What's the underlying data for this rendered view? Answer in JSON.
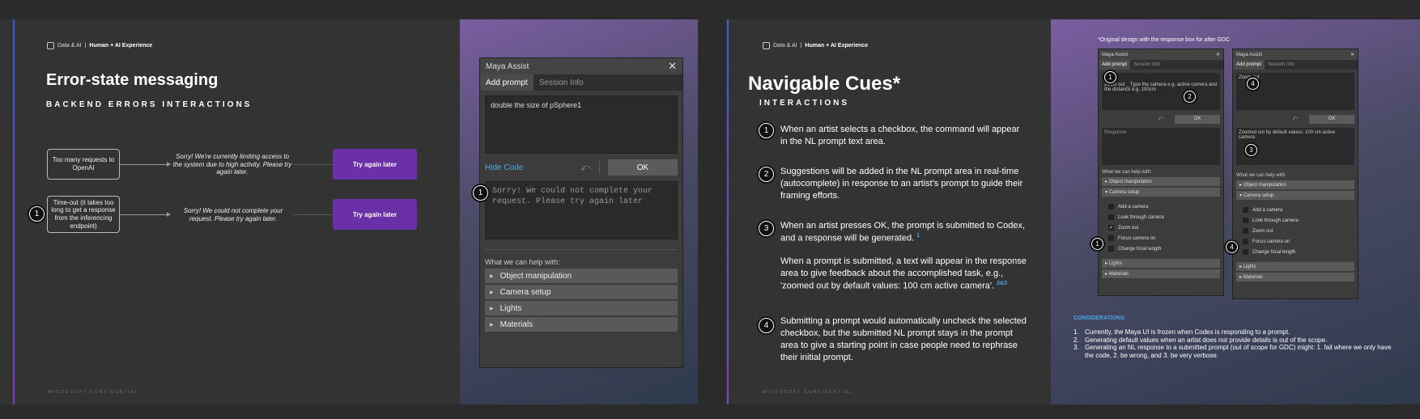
{
  "slide1": {
    "brand": {
      "org": "Data & AI",
      "team": "Human + AI Experience"
    },
    "title": "Error-state messaging",
    "subtitle": "BACKEND ERRORS INTERACTIONS",
    "flows": [
      {
        "cause": "Too many requests to OpenAI",
        "message": "Sorry! We're currently limiting access to the system due to high activity. Please try again later.",
        "action": "Try again later"
      },
      {
        "cause": "Time-out (it takes too long to get a response from the inferencing endpoint)",
        "message": "Sorry! We could not complete your request. Please try again later.",
        "action": "Try again later"
      }
    ],
    "badge": "1",
    "confidential": "MICROSOFT CONFIDENTIAL",
    "maya": {
      "title": "Maya Assist",
      "tabs": [
        "Add prompt",
        "Session Info"
      ],
      "prompt": "double the size of pSphere1",
      "hide_code": "Hide Code",
      "ok": "OK",
      "response": "Sorry! We could not complete your request. Please try again later",
      "help_label": "What we can help with:",
      "categories": [
        "Object manipulation",
        "Camera setup",
        "Lights",
        "Materials"
      ]
    }
  },
  "slide2": {
    "brand": {
      "org": "Data & AI",
      "team": "Human + AI Experience"
    },
    "title": "Navigable Cues*",
    "subtitle": "INTERACTIONS",
    "cues": [
      {
        "n": "1",
        "text": "When an artist selects a checkbox, the command will appear in the NL prompt text area.",
        "sup": ""
      },
      {
        "n": "2",
        "text": "Suggestions will be added in the NL prompt area in real-time (autocomplete) in response to an artist's prompt to guide their framing efforts.",
        "sup": ""
      },
      {
        "n": "3",
        "text": "When an artist presses OK, the prompt is submitted to Codex, and a response will be generated.",
        "sup": "1"
      },
      {
        "n": "",
        "text": "When a prompt is submitted, a text will appear in the response area to give feedback about the accomplished task, e.g., 'zoomed out by default values: 100 cm active camera'.",
        "sup": "2&3"
      },
      {
        "n": "4",
        "text": "Submitting a prompt would automatically uncheck the selected checkbox, but the submitted NL prompt stays in the prompt area to give a starting point in case people need to rephrase their initial prompt.",
        "sup": ""
      }
    ],
    "note": "*Original design with the response box for after GDC",
    "confidential": "MICROSOFT CONFIDENTIAL",
    "left_dialog": {
      "title": "Maya Assist",
      "tabs": [
        "Add prompt",
        "Session Info"
      ],
      "prompt": "Zoom out _ Type the camera e.g. active camera and the distance e.g. 100cm",
      "ok": "OK",
      "response_placeholder": "Response",
      "help_label": "What we can help with:",
      "categories": [
        "Object manipulation",
        "Camera setup"
      ],
      "camera_items": [
        "Add a camera",
        "Look through camera",
        "Zoom out",
        "Focus camera on",
        "Change focal length"
      ],
      "checked_index": 2,
      "more": [
        "Lights",
        "Materials"
      ]
    },
    "right_dialog": {
      "title": "Maya Assist",
      "tabs": [
        "Add prompt",
        "Session Info"
      ],
      "prompt": "Zoom out",
      "ok": "OK",
      "response": "Zoomed out by default values: 100 cm active camera",
      "help_label": "What we can help with:",
      "categories": [
        "Object manipulation",
        "Camera setup"
      ],
      "camera_items": [
        "Add a camera",
        "Look through camera",
        "Zoom out",
        "Focus camera on",
        "Change focal length"
      ],
      "more": [
        "Lights",
        "Materials"
      ]
    },
    "considerations_title": "CONSIDERATIONS",
    "considerations": [
      "Currently, the Maya UI is frozen when Codex is responding to a prompt.",
      "Generating default values when an artist does not provide details is out of the scope.",
      "Generating an NL response to a submitted prompt (out of scope for GDC) might: 1. fail where we only have the code, 2. be wrong, and 3. be very verbose."
    ]
  }
}
